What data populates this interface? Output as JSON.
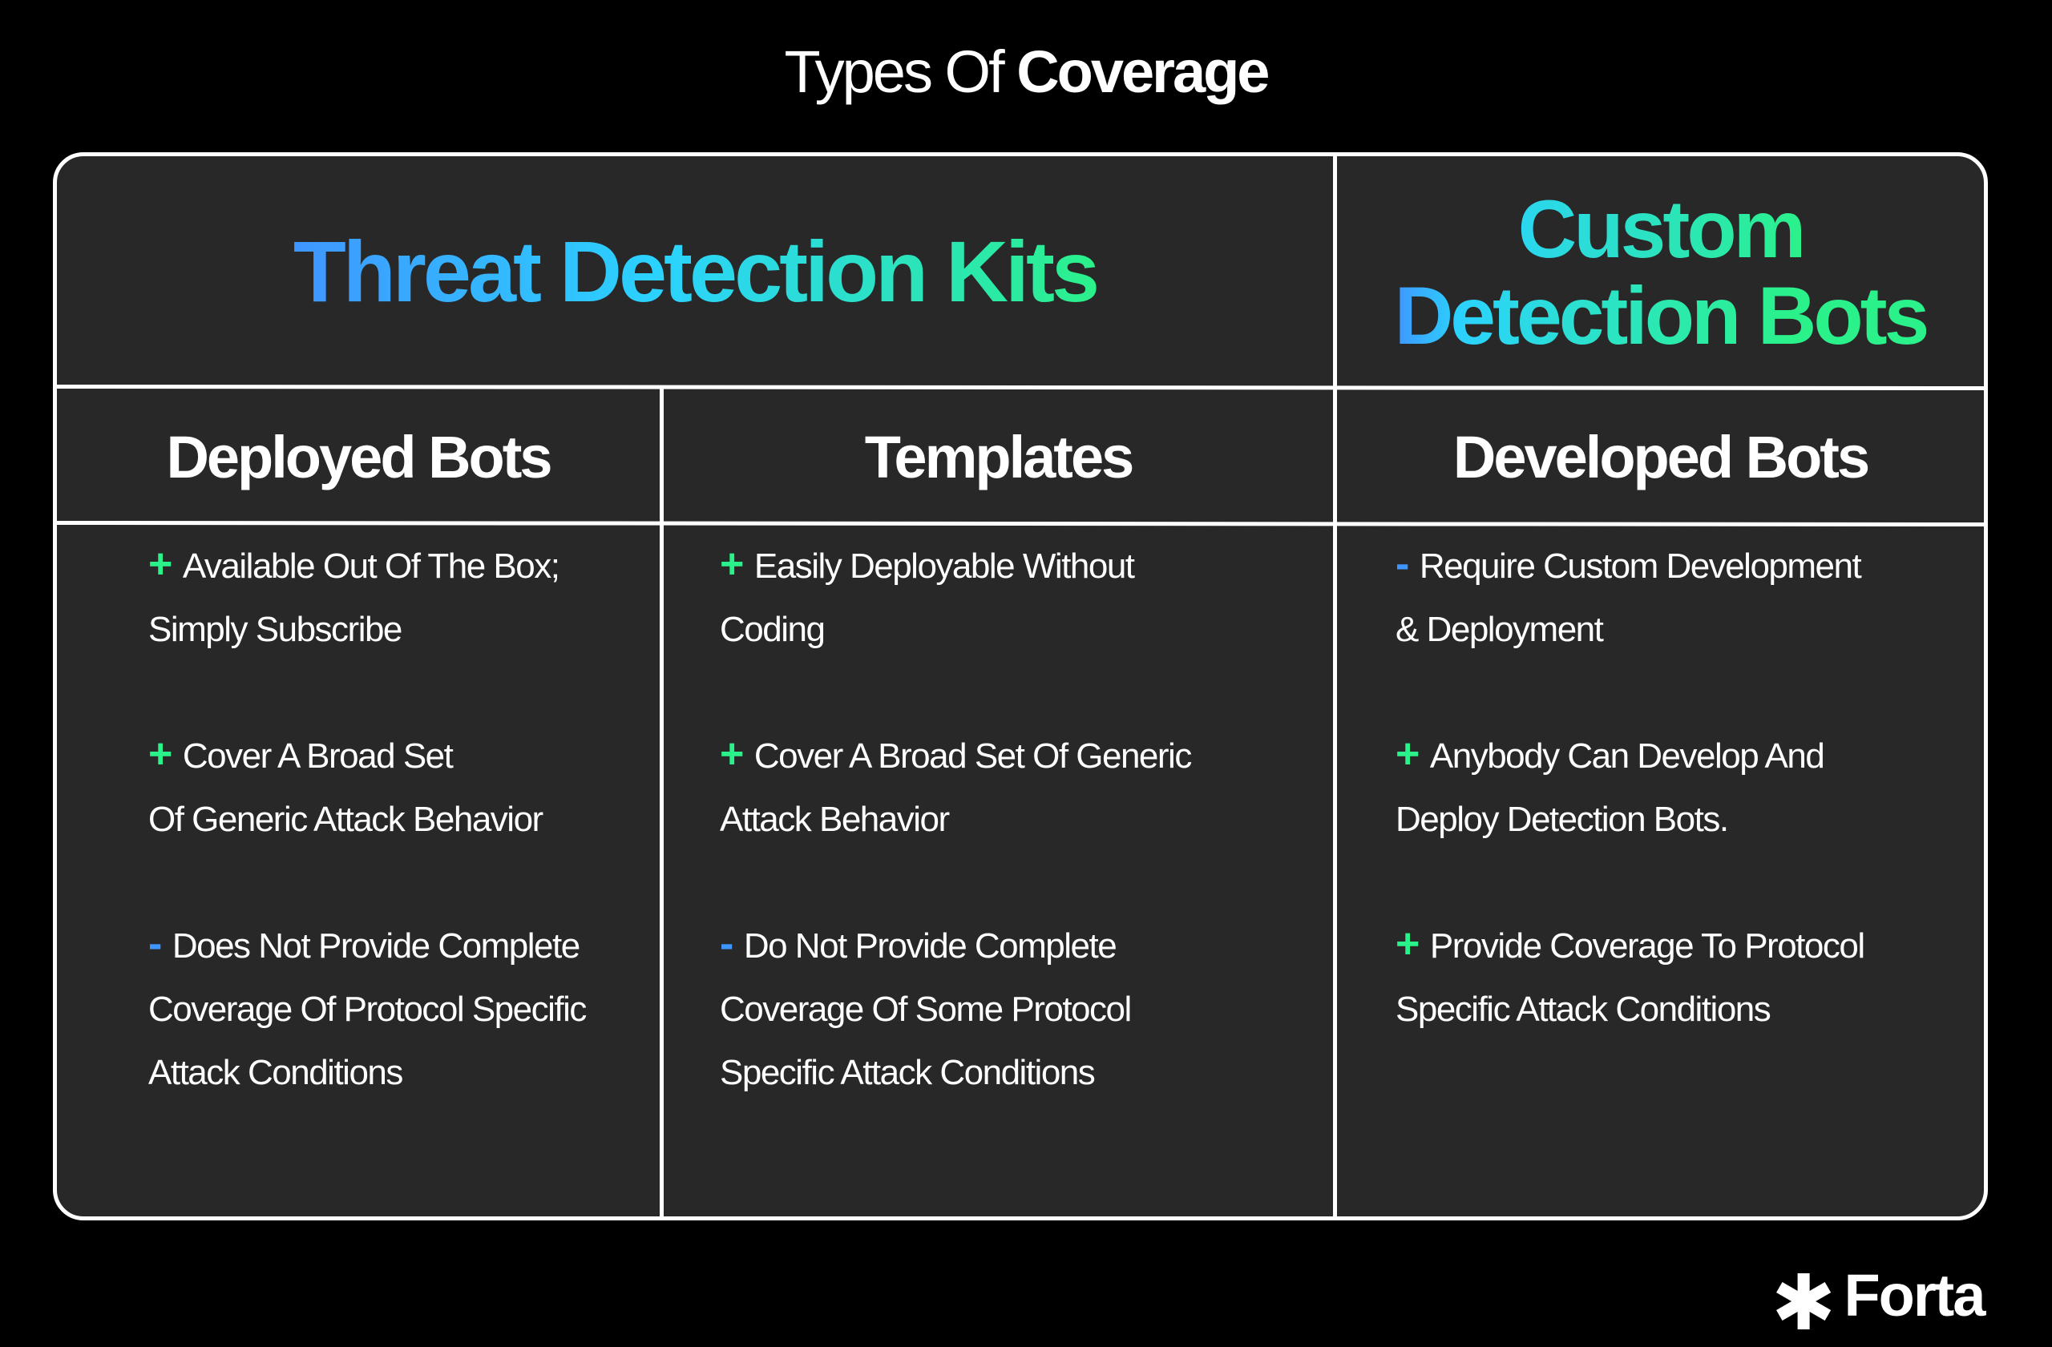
{
  "title": {
    "light": "Types Of ",
    "bold": "Coverage"
  },
  "headers": {
    "threat_kits": "Threat Detection Kits",
    "custom_bots_line1": "Custom",
    "custom_bots_line2": "Detection Bots"
  },
  "colors": {
    "background": "#000000",
    "panel": "#282828",
    "border": "#ffffff",
    "gradient_blue": "#3f96ff",
    "gradient_cyan": "#2bd2ff",
    "gradient_green": "#2bf18a",
    "plus": "#2bf18a",
    "minus": "#3f96ff"
  },
  "columns": [
    {
      "heading": "Deployed Bots",
      "items": [
        {
          "sign": "+",
          "lines": [
            "Available Out Of The Box;",
            "Simply Subscribe"
          ]
        },
        {
          "sign": "+",
          "lines": [
            "Cover A Broad Set",
            "Of Generic Attack Behavior"
          ]
        },
        {
          "sign": "-",
          "lines": [
            "Does Not Provide Complete",
            "Coverage Of  Protocol Specific",
            "Attack Conditions"
          ]
        }
      ]
    },
    {
      "heading": "Templates",
      "items": [
        {
          "sign": "+",
          "lines": [
            "Easily Deployable Without",
            "Coding"
          ]
        },
        {
          "sign": "+",
          "lines": [
            "Cover A Broad Set Of Generic",
            "Attack Behavior"
          ]
        },
        {
          "sign": "-",
          "lines": [
            "Do Not Provide Complete",
            "Coverage Of Some Protocol",
            "Specific Attack Conditions"
          ]
        }
      ]
    },
    {
      "heading": "Developed Bots",
      "items": [
        {
          "sign": "-",
          "lines": [
            "Require Custom Development",
            "& Deployment"
          ]
        },
        {
          "sign": "+",
          "lines": [
            "Anybody Can Develop And",
            "Deploy Detection Bots."
          ]
        },
        {
          "sign": "+",
          "lines": [
            "Provide Coverage To Protocol",
            "Specific Attack Conditions"
          ]
        }
      ]
    }
  ],
  "logo": {
    "icon": "asterisk-star-icon",
    "text": "Forta"
  }
}
